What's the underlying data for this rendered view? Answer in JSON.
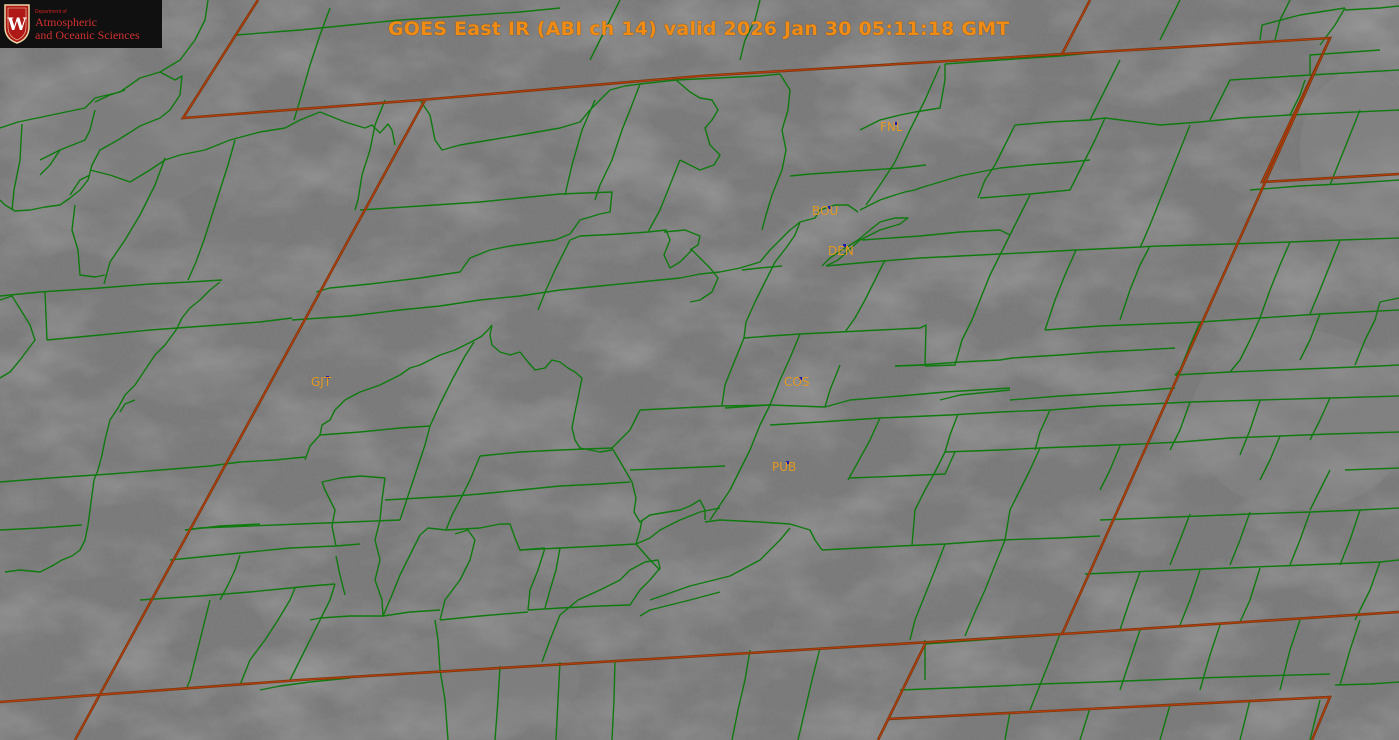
{
  "title": "GOES East IR (ABI ch 14) valid 2026 Jan 30 05:11:18 GMT",
  "logo": {
    "department_line": "Department of",
    "line1": "Atmospheric",
    "line2": "and Oceanic Sciences",
    "seal_letter": "W"
  },
  "stations": [
    {
      "id": "FNL",
      "label": "FNL"
    },
    {
      "id": "BOU",
      "label": "BOU"
    },
    {
      "id": "DEN",
      "label": "DEN"
    },
    {
      "id": "GJT",
      "label": "GJT"
    },
    {
      "id": "COS",
      "label": "COS"
    },
    {
      "id": "PUB",
      "label": "PUB"
    }
  ],
  "colors": {
    "satellite_gray": "#7a7a7a",
    "county_lines": "#0f7a0f",
    "state_lines": "#7a3a0a",
    "state_highlight": "#c23a12",
    "title_text": "#f08c14",
    "station_text": "#e39820",
    "station_marker": "#1a1ab0",
    "logo_text": "#d03030",
    "logo_bg": "#101010"
  }
}
